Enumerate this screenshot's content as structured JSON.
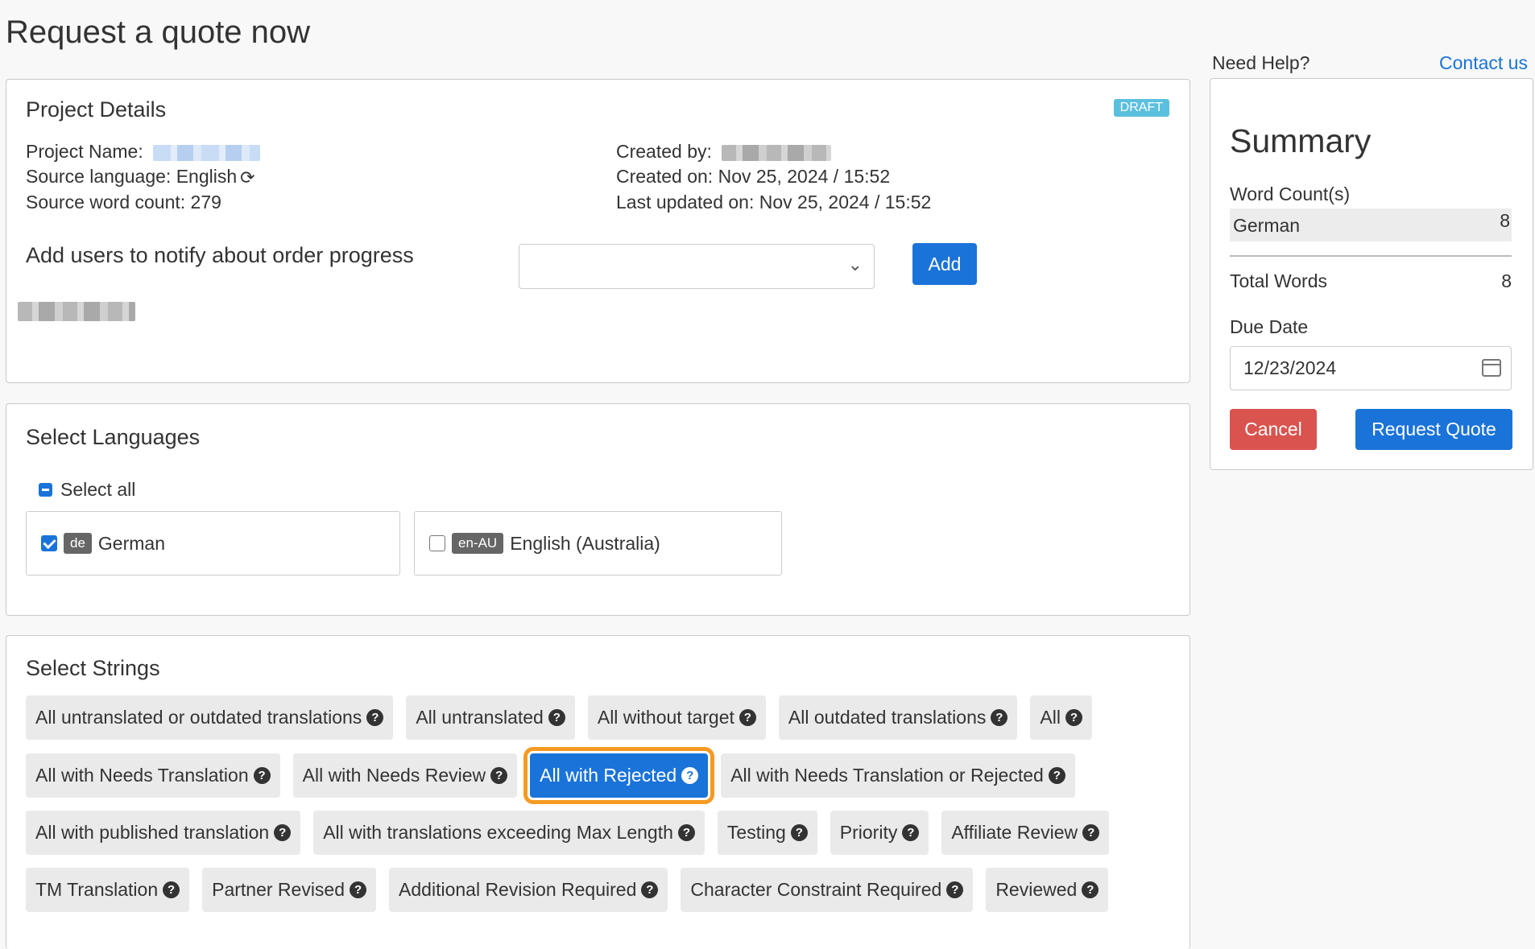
{
  "page": {
    "title": "Request a quote now"
  },
  "project": {
    "title": "Project Details",
    "badge": "DRAFT",
    "name_label": "Project Name:",
    "source_language": "Source language: English",
    "source_word_count": "Source word count: 279",
    "created_by_label": "Created by:",
    "created_on": "Created on: Nov 25, 2024 / 15:52",
    "last_updated": "Last updated on: Nov 25, 2024 / 15:52",
    "notify_label": "Add users to notify about order progress",
    "add_button": "Add"
  },
  "languages": {
    "title": "Select Languages",
    "select_all": "Select all",
    "items": [
      {
        "code": "de",
        "name": "German",
        "checked": true
      },
      {
        "code": "en-AU",
        "name": "English (Australia)",
        "checked": false
      }
    ]
  },
  "strings": {
    "title": "Select Strings",
    "rows": [
      [
        "All untranslated or outdated translations",
        "All untranslated",
        "All without target",
        "All outdated translations",
        "All"
      ],
      [
        "All with Needs Translation",
        "All with Needs Review",
        "All with Rejected",
        "All with Needs Translation or Rejected"
      ],
      [
        "All with published translation",
        "All with translations exceeding Max Length",
        "Testing",
        "Priority",
        "Affiliate Review"
      ],
      [
        "TM Translation",
        "Partner Revised",
        "Additional Revision Required",
        "Character Constraint Required",
        "Reviewed"
      ]
    ],
    "active": "All with Rejected",
    "help_icon": "question-circle-icon"
  },
  "help": {
    "label": "Need Help?",
    "link": "Contact us"
  },
  "summary": {
    "title": "Summary",
    "word_count_label": "Word Count(s)",
    "word_counts": [
      {
        "language": "German",
        "count": "8"
      }
    ],
    "total_label": "Total Words",
    "total_value": "8",
    "due_label": "Due Date",
    "due_value": "12/23/2024",
    "cancel": "Cancel",
    "request": "Request Quote"
  },
  "colors": {
    "primary": "#1a73d9",
    "danger": "#d9534f",
    "badge": "#5bc0de",
    "highlight": "#f59a23"
  }
}
